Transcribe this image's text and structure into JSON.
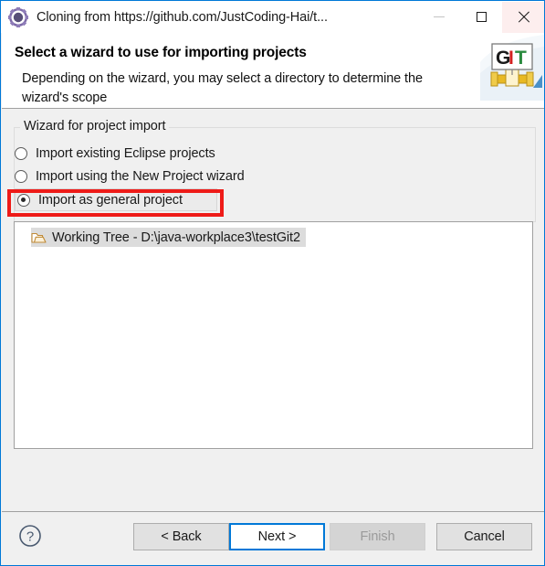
{
  "window": {
    "title": "Cloning from https://github.com/JustCoding-Hai/t...",
    "app_icon": "gear-icon",
    "accent_color": "#0078d7",
    "controls": {
      "minimize": "—",
      "maximize": "□",
      "close": "✕"
    }
  },
  "header": {
    "title": "Select a wizard to use for importing projects",
    "description": "Depending on the wizard, you may select a directory to determine the wizard's scope",
    "banner": {
      "name": "git-logo",
      "letters": [
        "G",
        "I",
        "T"
      ],
      "letter_colors": [
        "#1a1a1a",
        "#d32020",
        "#2a8a3e"
      ],
      "pipe_color": "#e8b923",
      "triangle_color": "#4a90c8"
    }
  },
  "groupbox": {
    "title": "Wizard for project import",
    "options": [
      {
        "label": "Import existing Eclipse projects",
        "checked": false
      },
      {
        "label": "Import using the New Project wizard",
        "checked": false
      },
      {
        "label": "Import as general project",
        "checked": true
      }
    ]
  },
  "annotation": {
    "color": "#ee1b18",
    "target": "Import as general project"
  },
  "tree": {
    "items": [
      {
        "label": "Working Tree - D:\\java-workplace3\\testGit2",
        "icon": "open-folder-icon",
        "selected": true
      }
    ]
  },
  "footer": {
    "help_icon": "question-mark-icon",
    "buttons": [
      {
        "label": "< Back",
        "state": "enabled"
      },
      {
        "label": "Next >",
        "state": "focused"
      },
      {
        "label": "Finish",
        "state": "disabled"
      },
      {
        "label": "Cancel",
        "state": "enabled"
      }
    ]
  }
}
